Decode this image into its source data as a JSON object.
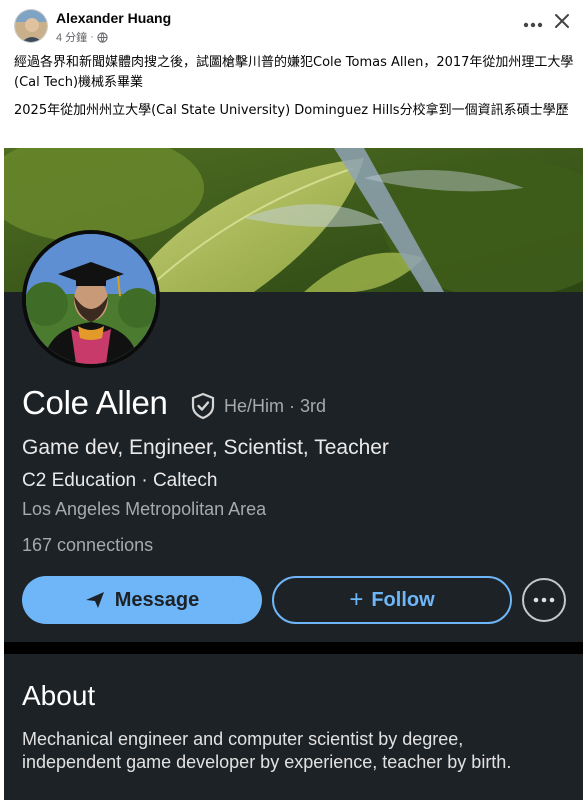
{
  "post": {
    "author": "Alexander Huang",
    "time": "4 分鐘",
    "dot": "·",
    "paragraph1": "經過各界和新聞媒體肉搜之後，試圖槍擊川普的嫌犯Cole Tomas Allen，2017年從加州理工大學(Cal Tech)機械系畢業",
    "paragraph2": "2025年從加州州立大學(Cal State University) Dominguez Hills分校拿到一個資訊系碩士學歷",
    "more_icon": "ellipsis-icon",
    "close_icon": "close-icon"
  },
  "profile": {
    "name": "Cole Allen",
    "pronouns_degree": "He/Him · 3rd",
    "headline": "Game dev, Engineer, Scientist,  Teacher",
    "company_school": "C2 Education · Caltech",
    "location": "Los Angeles Metropolitan Area",
    "connections": "167 connections",
    "verified_icon": "shield-check-icon"
  },
  "actions": {
    "message_label": "Message",
    "follow_label": "Follow",
    "follow_prefix": "+",
    "more_icon": "ellipsis-circle-icon"
  },
  "about": {
    "title": "About",
    "text": "Mechanical engineer and computer scientist by degree, independent game developer by experience, teacher by birth."
  },
  "colors": {
    "card_bg": "#1d2226",
    "accent": "#6fb6f8",
    "secondary_text": "#a7a9ab"
  }
}
